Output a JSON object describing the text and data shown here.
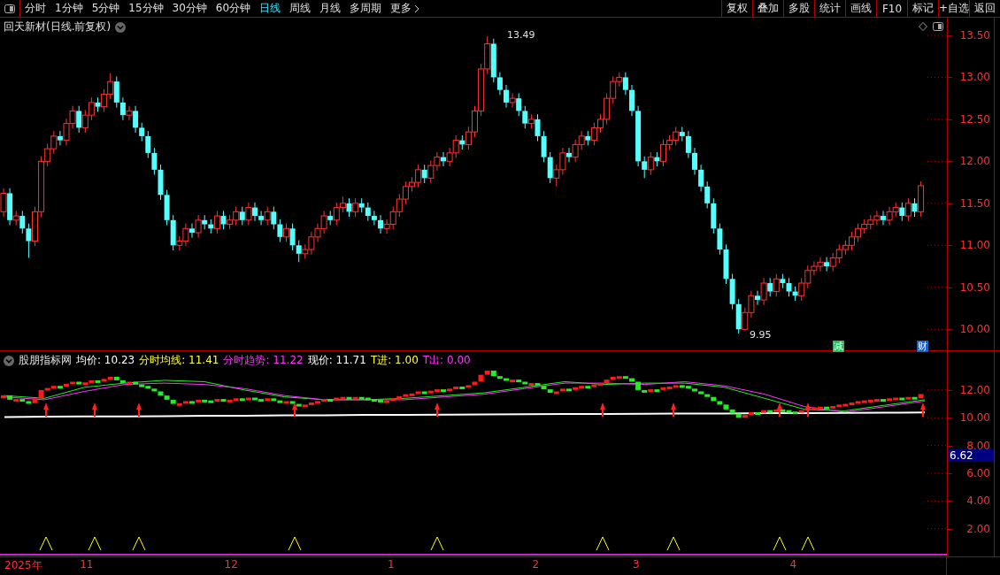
{
  "toolbar": {
    "periods": [
      {
        "label": "分时",
        "selected": false
      },
      {
        "label": "1分钟",
        "selected": false
      },
      {
        "label": "5分钟",
        "selected": false
      },
      {
        "label": "15分钟",
        "selected": false
      },
      {
        "label": "30分钟",
        "selected": false
      },
      {
        "label": "60分钟",
        "selected": false
      },
      {
        "label": "日线",
        "selected": true
      },
      {
        "label": "周线",
        "selected": false
      },
      {
        "label": "月线",
        "selected": false
      },
      {
        "label": "多周期",
        "selected": false
      }
    ],
    "more": "更多",
    "actions": [
      "复权",
      "叠加",
      "多股",
      "统计",
      "画线",
      "F10",
      "标记",
      "+自选",
      "返回"
    ]
  },
  "main_chart": {
    "title": "回天新材(日线.前复权)",
    "high_label": "13.49",
    "low_label": "9.95",
    "markers": [
      {
        "text": "减",
        "kind": "reduce",
        "color": "#1fbf5f"
      },
      {
        "text": "财",
        "kind": "finance",
        "color": "#1a5fc8"
      }
    ],
    "chart_data": {
      "type": "candlestick",
      "ylim": [
        9.75,
        13.71
      ],
      "yticks": [
        {
          "value": 13.5,
          "label": "13.50"
        },
        {
          "value": 13,
          "label": "13.00"
        },
        {
          "value": 12.5,
          "label": "12.50"
        },
        {
          "value": 12,
          "label": "12.00"
        },
        {
          "value": 11.5,
          "label": "11.50"
        },
        {
          "value": 11,
          "label": "11.00"
        },
        {
          "value": 10.5,
          "label": "10.50"
        },
        {
          "value": 10,
          "label": "10.00"
        }
      ],
      "ohlc": [
        [
          11.4,
          11.68,
          11.34,
          11.62
        ],
        [
          11.62,
          11.68,
          11.24,
          11.3
        ],
        [
          11.3,
          11.41,
          11.24,
          11.35
        ],
        [
          11.35,
          11.41,
          11.14,
          11.2
        ],
        [
          11.2,
          11.26,
          10.85,
          11.05
        ],
        [
          11.05,
          11.46,
          10.99,
          11.4
        ],
        [
          11.4,
          12.06,
          11.34,
          12.0
        ],
        [
          12.0,
          12.21,
          11.94,
          12.15
        ],
        [
          12.15,
          12.36,
          12.09,
          12.3
        ],
        [
          12.3,
          12.36,
          12.19,
          12.25
        ],
        [
          12.25,
          12.51,
          12.19,
          12.45
        ],
        [
          12.45,
          12.66,
          12.39,
          12.6
        ],
        [
          12.6,
          12.66,
          12.34,
          12.4
        ],
        [
          12.4,
          12.61,
          12.34,
          12.55
        ],
        [
          12.55,
          12.76,
          12.49,
          12.7
        ],
        [
          12.7,
          12.76,
          12.59,
          12.65
        ],
        [
          12.65,
          12.86,
          12.59,
          12.8
        ],
        [
          12.8,
          13.05,
          12.74,
          12.95
        ],
        [
          12.95,
          13.01,
          12.64,
          12.7
        ],
        [
          12.7,
          12.76,
          12.49,
          12.55
        ],
        [
          12.55,
          12.66,
          12.49,
          12.6
        ],
        [
          12.6,
          12.66,
          12.34,
          12.4
        ],
        [
          12.4,
          12.46,
          12.24,
          12.3
        ],
        [
          12.3,
          12.36,
          12.04,
          12.1
        ],
        [
          12.1,
          12.16,
          11.84,
          11.9
        ],
        [
          11.9,
          11.96,
          11.54,
          11.6
        ],
        [
          11.6,
          11.66,
          11.24,
          11.3
        ],
        [
          11.3,
          11.36,
          10.94,
          11.0
        ],
        [
          11.0,
          11.11,
          10.94,
          11.05
        ],
        [
          11.05,
          11.26,
          10.99,
          11.2
        ],
        [
          11.2,
          11.26,
          11.09,
          11.15
        ],
        [
          11.15,
          11.36,
          11.09,
          11.3
        ],
        [
          11.3,
          11.36,
          11.19,
          11.25
        ],
        [
          11.25,
          11.31,
          11.14,
          11.2
        ],
        [
          11.2,
          11.41,
          11.14,
          11.35
        ],
        [
          11.35,
          11.41,
          11.19,
          11.25
        ],
        [
          11.25,
          11.36,
          11.19,
          11.3
        ],
        [
          11.3,
          11.46,
          11.24,
          11.4
        ],
        [
          11.4,
          11.46,
          11.24,
          11.3
        ],
        [
          11.3,
          11.51,
          11.24,
          11.45
        ],
        [
          11.45,
          11.51,
          11.29,
          11.35
        ],
        [
          11.35,
          11.41,
          11.24,
          11.3
        ],
        [
          11.3,
          11.46,
          11.24,
          11.4
        ],
        [
          11.4,
          11.46,
          11.19,
          11.25
        ],
        [
          11.25,
          11.31,
          11.04,
          11.1
        ],
        [
          11.1,
          11.26,
          11.04,
          11.2
        ],
        [
          11.2,
          11.26,
          10.94,
          11.0
        ],
        [
          11.0,
          11.06,
          10.8,
          10.9
        ],
        [
          10.9,
          11.01,
          10.84,
          10.95
        ],
        [
          10.95,
          11.16,
          10.89,
          11.1
        ],
        [
          11.1,
          11.26,
          11.04,
          11.2
        ],
        [
          11.2,
          11.41,
          11.14,
          11.35
        ],
        [
          11.35,
          11.41,
          11.24,
          11.3
        ],
        [
          11.3,
          11.51,
          11.24,
          11.45
        ],
        [
          11.45,
          11.58,
          11.39,
          11.5
        ],
        [
          11.5,
          11.56,
          11.34,
          11.4
        ],
        [
          11.4,
          11.56,
          11.34,
          11.5
        ],
        [
          11.5,
          11.56,
          11.39,
          11.45
        ],
        [
          11.45,
          11.51,
          11.29,
          11.35
        ],
        [
          11.35,
          11.41,
          11.24,
          11.3
        ],
        [
          11.3,
          11.36,
          11.14,
          11.2
        ],
        [
          11.2,
          11.31,
          11.14,
          11.25
        ],
        [
          11.25,
          11.46,
          11.19,
          11.4
        ],
        [
          11.4,
          11.61,
          11.34,
          11.55
        ],
        [
          11.55,
          11.76,
          11.49,
          11.7
        ],
        [
          11.7,
          11.81,
          11.64,
          11.75
        ],
        [
          11.75,
          11.96,
          11.69,
          11.9
        ],
        [
          11.9,
          11.96,
          11.74,
          11.8
        ],
        [
          11.8,
          12.01,
          11.74,
          11.95
        ],
        [
          11.95,
          12.11,
          11.89,
          12.05
        ],
        [
          12.05,
          12.11,
          11.94,
          12.0
        ],
        [
          12.0,
          12.16,
          11.94,
          12.1
        ],
        [
          12.1,
          12.31,
          12.04,
          12.25
        ],
        [
          12.25,
          12.31,
          12.14,
          12.2
        ],
        [
          12.2,
          12.41,
          12.14,
          12.35
        ],
        [
          12.35,
          12.66,
          12.29,
          12.6
        ],
        [
          12.6,
          13.16,
          12.54,
          13.1
        ],
        [
          13.1,
          13.49,
          13.04,
          13.4
        ],
        [
          13.4,
          13.46,
          12.94,
          13.0
        ],
        [
          13.0,
          13.06,
          12.79,
          12.85
        ],
        [
          12.85,
          12.91,
          12.64,
          12.7
        ],
        [
          12.7,
          12.81,
          12.64,
          12.75
        ],
        [
          12.75,
          12.81,
          12.54,
          12.6
        ],
        [
          12.6,
          12.66,
          12.39,
          12.45
        ],
        [
          12.45,
          12.56,
          12.39,
          12.5
        ],
        [
          12.5,
          12.56,
          12.24,
          12.3
        ],
        [
          12.3,
          12.36,
          11.99,
          12.05
        ],
        [
          12.05,
          12.11,
          11.74,
          11.8
        ],
        [
          11.8,
          11.96,
          11.7,
          11.9
        ],
        [
          11.9,
          12.16,
          11.84,
          12.1
        ],
        [
          12.1,
          12.16,
          11.99,
          12.05
        ],
        [
          12.05,
          12.26,
          11.99,
          12.2
        ],
        [
          12.2,
          12.36,
          12.14,
          12.3
        ],
        [
          12.3,
          12.36,
          12.19,
          12.25
        ],
        [
          12.25,
          12.46,
          12.19,
          12.4
        ],
        [
          12.4,
          12.56,
          12.34,
          12.5
        ],
        [
          12.5,
          12.81,
          12.44,
          12.75
        ],
        [
          12.75,
          13.01,
          12.69,
          12.95
        ],
        [
          12.95,
          13.06,
          12.89,
          13.0
        ],
        [
          13.0,
          13.06,
          12.79,
          12.85
        ],
        [
          12.85,
          12.91,
          12.54,
          12.6
        ],
        [
          12.6,
          12.66,
          11.94,
          12.0
        ],
        [
          12.0,
          12.06,
          11.8,
          11.9
        ],
        [
          11.9,
          12.11,
          11.84,
          12.05
        ],
        [
          12.05,
          12.11,
          11.94,
          12.0
        ],
        [
          12.0,
          12.26,
          11.94,
          12.2
        ],
        [
          12.2,
          12.31,
          12.14,
          12.25
        ],
        [
          12.25,
          12.41,
          12.19,
          12.35
        ],
        [
          12.35,
          12.41,
          12.24,
          12.3
        ],
        [
          12.3,
          12.36,
          12.04,
          12.1
        ],
        [
          12.1,
          12.16,
          11.84,
          11.9
        ],
        [
          11.9,
          11.96,
          11.64,
          11.7
        ],
        [
          11.7,
          11.76,
          11.44,
          11.5
        ],
        [
          11.5,
          11.56,
          11.14,
          11.2
        ],
        [
          11.2,
          11.26,
          10.89,
          10.95
        ],
        [
          10.95,
          11.01,
          10.54,
          10.6
        ],
        [
          10.6,
          10.66,
          10.24,
          10.3
        ],
        [
          10.3,
          10.36,
          9.95,
          10.0
        ],
        [
          10.0,
          10.26,
          9.98,
          10.2
        ],
        [
          10.2,
          10.46,
          10.14,
          10.4
        ],
        [
          10.4,
          10.46,
          10.29,
          10.35
        ],
        [
          10.35,
          10.61,
          10.29,
          10.55
        ],
        [
          10.55,
          10.61,
          10.39,
          10.45
        ],
        [
          10.45,
          10.66,
          10.39,
          10.6
        ],
        [
          10.6,
          10.66,
          10.49,
          10.55
        ],
        [
          10.55,
          10.61,
          10.39,
          10.45
        ],
        [
          10.45,
          10.51,
          10.34,
          10.4
        ],
        [
          10.4,
          10.61,
          10.34,
          10.55
        ],
        [
          10.55,
          10.76,
          10.49,
          10.7
        ],
        [
          10.7,
          10.81,
          10.64,
          10.75
        ],
        [
          10.75,
          10.86,
          10.69,
          10.8
        ],
        [
          10.8,
          10.86,
          10.69,
          10.75
        ],
        [
          10.75,
          10.91,
          10.69,
          10.85
        ],
        [
          10.85,
          11.01,
          10.79,
          10.95
        ],
        [
          10.95,
          11.06,
          10.89,
          11.0
        ],
        [
          11.0,
          11.16,
          10.94,
          11.1
        ],
        [
          11.1,
          11.26,
          11.04,
          11.2
        ],
        [
          11.2,
          11.31,
          11.14,
          11.25
        ],
        [
          11.25,
          11.36,
          11.19,
          11.3
        ],
        [
          11.3,
          11.41,
          11.24,
          11.35
        ],
        [
          11.35,
          11.41,
          11.24,
          11.3
        ],
        [
          11.3,
          11.46,
          11.24,
          11.4
        ],
        [
          11.4,
          11.51,
          11.34,
          11.45
        ],
        [
          11.45,
          11.51,
          11.29,
          11.35
        ],
        [
          11.35,
          11.56,
          11.29,
          11.5
        ],
        [
          11.5,
          11.56,
          11.34,
          11.4
        ],
        [
          11.4,
          11.76,
          11.34,
          11.71
        ]
      ]
    }
  },
  "indicator": {
    "name": "股朋指标网",
    "readings": [
      {
        "text": "均价: 10.23",
        "color": "#ffffff"
      },
      {
        "text": "分时均线: 11.41",
        "color": "#ffff33"
      },
      {
        "text": "分时趋势: 11.22",
        "color": "#ff33ff"
      },
      {
        "text": "现价: 11.71",
        "color": "#ffffff"
      },
      {
        "text": "T进: 1.00",
        "color": "#ffff33"
      },
      {
        "text": "T出: 0.00",
        "color": "#ff33ff"
      }
    ],
    "current_tag": "6.62",
    "chart_data": {
      "type": "line",
      "ylim": [
        0,
        14.8
      ],
      "yticks": [
        {
          "value": 12,
          "label": "12.00"
        },
        {
          "value": 10,
          "label": "10.00"
        },
        {
          "value": 8,
          "label": "8.00"
        },
        {
          "value": 6,
          "label": "6.00"
        },
        {
          "value": 4,
          "label": "4.00"
        },
        {
          "value": 2,
          "label": "2.00"
        }
      ],
      "series": [
        {
          "color": "#22ee22",
          "values": [
            11.6,
            11.4,
            12.2,
            12.5,
            12.7,
            12.6,
            12.0,
            11.5,
            11.3,
            11.3,
            11.4,
            11.6,
            11.8,
            12.2,
            12.6,
            12.4,
            12.5,
            12.5,
            12.2,
            11.4,
            10.6,
            10.5,
            10.9,
            11.3
          ]
        },
        {
          "color": "#ff33ff",
          "values": [
            11.5,
            11.3,
            11.9,
            12.4,
            12.5,
            12.4,
            12.1,
            11.6,
            11.3,
            11.3,
            11.3,
            11.5,
            11.7,
            12.1,
            12.5,
            12.5,
            12.4,
            12.6,
            12.3,
            11.7,
            10.8,
            10.4,
            10.8,
            11.2
          ]
        },
        {
          "color": "#ffffff",
          "values": [
            10.05,
            10.07,
            10.09,
            10.1,
            10.12,
            10.14,
            10.15,
            10.17,
            10.18,
            10.2,
            10.21,
            10.22,
            10.24,
            10.25,
            10.27,
            10.28,
            10.29,
            10.3,
            10.31,
            10.33,
            10.34,
            10.35,
            10.36,
            10.38
          ]
        }
      ]
    }
  },
  "date_axis": [
    "2025年",
    "11",
    "12",
    "1",
    "2",
    "3",
    "4"
  ]
}
